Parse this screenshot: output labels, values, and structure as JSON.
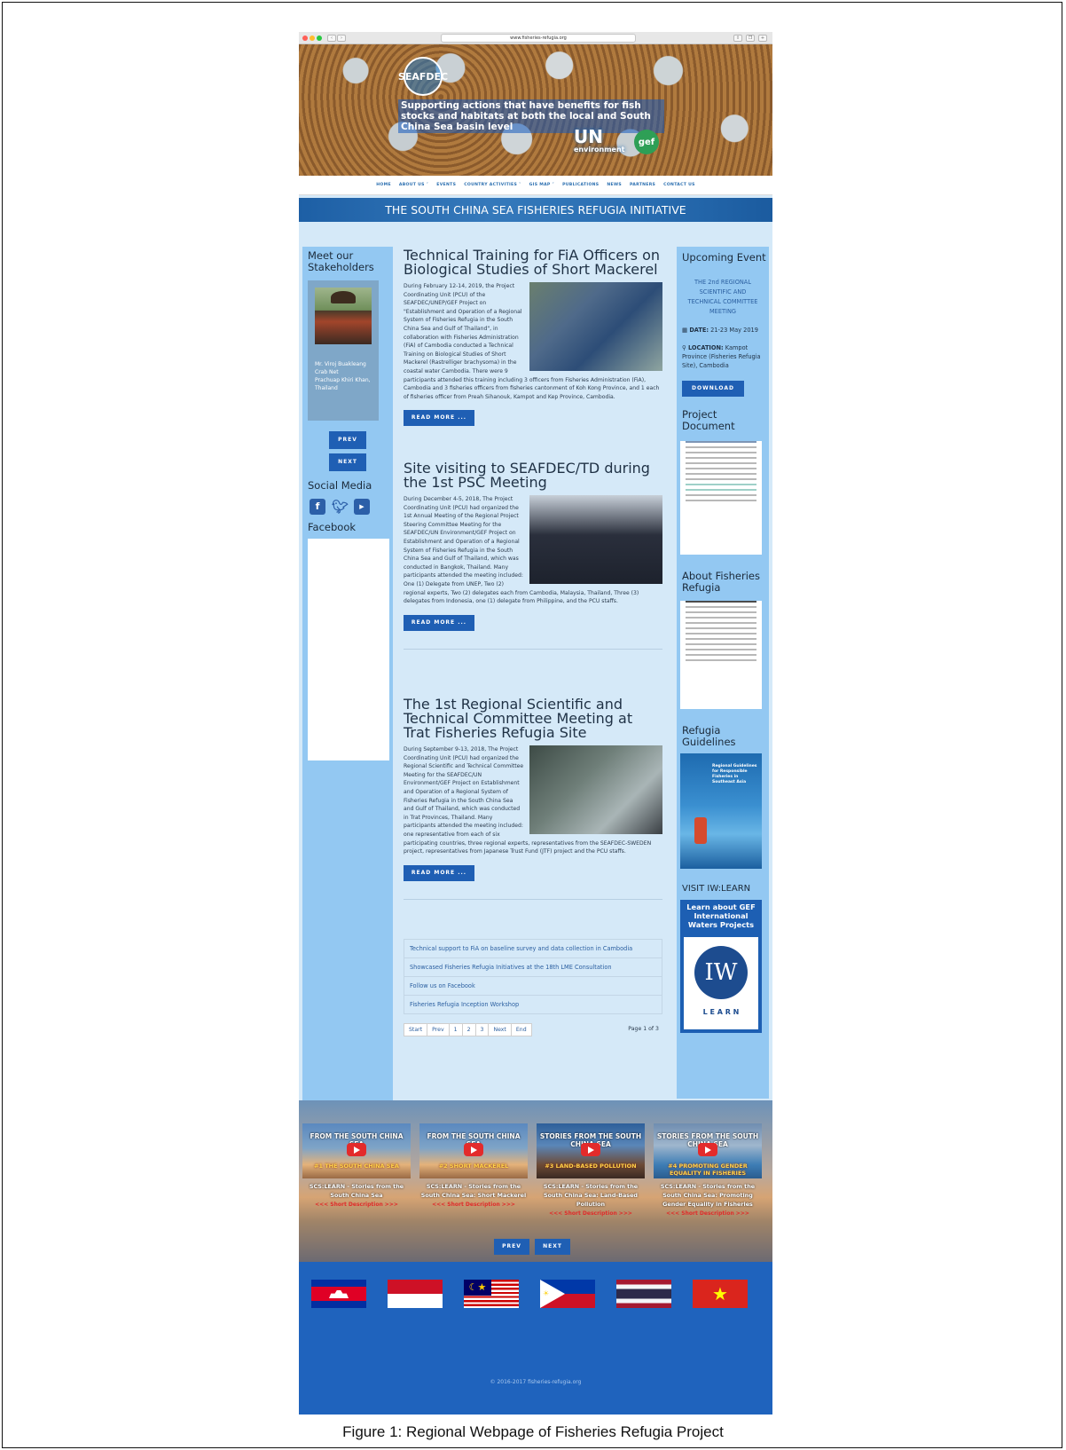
{
  "browser": {
    "url": "www.fisheries-refugia.org"
  },
  "hero": {
    "logo_text": "SEAFDEC",
    "tagline": "Supporting actions that have benefits for fish stocks and habitats at both the local and South China Sea basin level",
    "unep_text": "UN",
    "unep_sub": "environment",
    "gef_text": "gef"
  },
  "nav": {
    "items": [
      "HOME",
      "ABOUT US ˅",
      "EVENTS",
      "COUNTRY ACTIVITIES ˅",
      "GIS MAP ˅",
      "PUBLICATIONS",
      "NEWS",
      "PARTNERS",
      "CONTACT US"
    ]
  },
  "initiative_banner": "THE SOUTH CHINA SEA FISHERIES REFUGIA INITIATIVE",
  "left": {
    "stakeholders_title": "Meet our Stakeholders",
    "stakeholder_caption": [
      "Mr. Viroj Buakleang",
      "Crab Net",
      "Prachuap Khiri Khan,",
      "Thailand"
    ],
    "prev_label": "PREV",
    "next_label": "NEXT",
    "social_title": "Social Media",
    "social_icons": [
      "facebook-icon",
      "twitter-icon",
      "youtube-icon"
    ],
    "facebook_title": "Facebook"
  },
  "articles": [
    {
      "title": "Technical Training for FiA Officers on Biological Studies of Short Mackerel",
      "body": "During February 12-14, 2019, the Project Coordinating Unit (PCU) of the SEAFDEC/UNEP/GEF Project on \"Establishment and Operation of a Regional System of Fisheries Refugia in the South China Sea and Gulf of Thailand\", in collaboration with Fisheries Administration (FiA) of Cambodia conducted a Technical Training on Biological Studies of Short Mackerel (Rastrelliger brachysoma) in the coastal water Cambodia. There were 9 participants attended this training including 3 officers from Fisheries Administration (FiA), Cambodia and 3 fisheries officers from fisheries cantonment of Koh Kong Province, and 1 each of fisheries officer from Preah Sihanouk, Kampot and Kep Province, Cambodia.",
      "read_more": "READ MORE ..."
    },
    {
      "title": "Site visiting to SEAFDEC/TD during the 1st PSC Meeting",
      "body": "During December 4-5, 2018, The Project Coordinating Unit (PCU) had organized the 1st Annual Meeting of the Regional Project Steering Committee Meeting for the SEAFDEC/UN Environment/GEF Project on Establishment and Operation of a Regional System of Fisheries Refugia in the South China Sea and Gulf of Thailand, which was conducted in Bangkok, Thailand. Many participants attended the meeting included: One (1) Delegate from UNEP, Two (2) regional experts, Two (2) delegates each from Cambodia, Malaysia, Thailand, Three (3) delegates from Indonesia, one (1) delegate from Philippine, and the PCU staffs.",
      "read_more": "READ MORE ..."
    },
    {
      "title": "The 1st Regional Scientific and Technical Committee Meeting at Trat Fisheries Refugia Site",
      "body": "During September 9-13, 2018, The Project Coordinating Unit (PCU) had organized the Regional Scientific and Technical Committee Meeting for the SEAFDEC/UN Environment/GEF Project on Establishment and Operation of a Regional System of Fisheries Refugia in the South China Sea and Gulf of Thailand, which was conducted in Trat Provinces, Thailand. Many participants attended the meeting included: one representative from each of six participating countries, three regional experts, representatives from the SEAFDEC-SWEDEN project, representatives from Japanese Trust Fund (JTF) project and the PCU staffs.",
      "read_more": "READ MORE ..."
    }
  ],
  "more_links": [
    "Technical support to FiA on baseline survey and data collection in Cambodia",
    "Showcased Fisheries Refugia Initiatives at the 18th LME Consultation",
    "Follow us on Facebook",
    "Fisheries Refugia Inception Workshop"
  ],
  "pagination": {
    "items": [
      "Start",
      "Prev",
      "1",
      "2",
      "3",
      "Next",
      "End"
    ],
    "page_info": "Page 1 of 3"
  },
  "right": {
    "upcoming_title": "Upcoming Event",
    "event_name": "THE 2nd REGIONAL SCIENTIFIC AND TECHNICAL COMMITTEE MEETING",
    "date_label": "DATE:",
    "date_value": "21-23 May 2019",
    "location_label": "LOCATION:",
    "location_value": "Kampot Province (Fisheries Refugia Site), Cambodia",
    "download_label": "DOWNLOAD",
    "project_doc_title": "Project Document",
    "about_title": "About Fisheries Refugia",
    "guidelines_title": "Refugia Guidelines",
    "guidelines_cover": "Regional Guidelines for Responsible Fisheries in Southeast Asia",
    "visit_title": "VISIT IW:LEARN",
    "iw_text": "Learn about GEF International Waters Projects",
    "iw_logo": "IW",
    "iw_learn": "L E A R N"
  },
  "stories": [
    {
      "thumb_title": "FROM THE SOUTH CHINA SEA",
      "episode": "#1 THE SOUTH CHINA SEA",
      "caption": "SCS:LEARN - Stories from the South China Sea",
      "short": "<<< Short Description >>>"
    },
    {
      "thumb_title": "FROM THE SOUTH CHINA SEA",
      "episode": "#2 SHORT MACKEREL",
      "caption": "SCS:LEARN - Stories from the South China Sea: Short Mackerel",
      "short": "<<< Short Description >>>"
    },
    {
      "thumb_title": "STORIES FROM THE SOUTH CHINA SEA",
      "episode": "#3 LAND-BASED POLLUTION",
      "caption": "SCS:LEARN - Stories from the South China Sea: Land-Based Pollution",
      "short": "<<< Short Description >>>"
    },
    {
      "thumb_title": "STORIES FROM THE SOUTH CHINA SEA",
      "episode": "#4 PROMOTING GENDER EQUALITY IN FISHERIES",
      "caption": "SCS:LEARN - Stories from the South China Sea: Promoting Gender Equality in Fisheries",
      "short": "<<< Short Description >>>"
    }
  ],
  "stories_nav": {
    "prev": "PREV",
    "next": "NEXT"
  },
  "flags": [
    "Cambodia",
    "Indonesia",
    "Malaysia",
    "Philippines",
    "Thailand",
    "Viet Nam"
  ],
  "footer": {
    "copyright": "© 2016-2017 fisheries-refugia.org"
  },
  "figure_caption": "Figure 1: Regional Webpage of Fisheries Refugia Project"
}
